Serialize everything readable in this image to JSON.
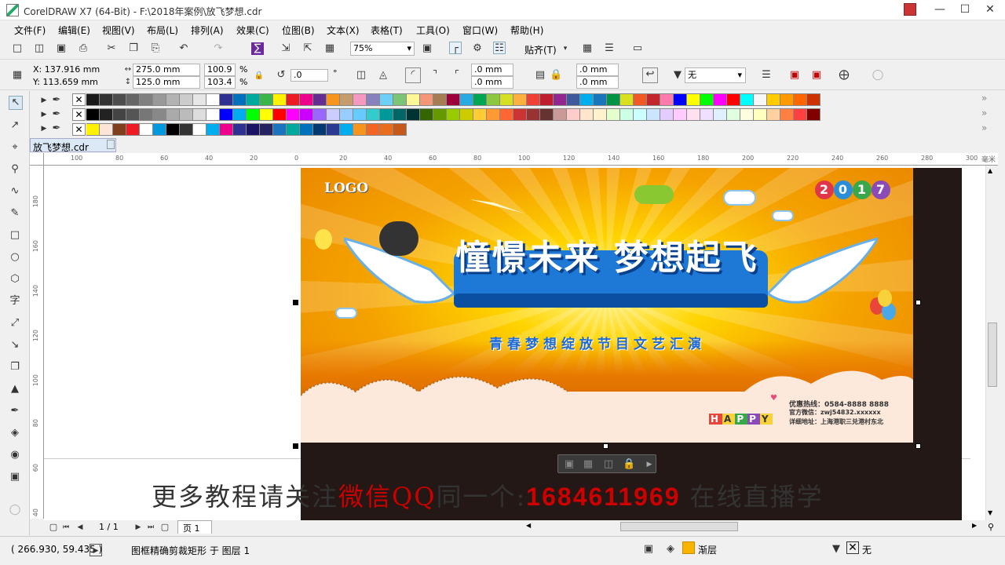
{
  "window": {
    "title": "CorelDRAW X7 (64-Bit) - F:\\2018年案例\\放飞梦想.cdr"
  },
  "menu": [
    "文件(F)",
    "编辑(E)",
    "视图(V)",
    "布局(L)",
    "排列(A)",
    "效果(C)",
    "位图(B)",
    "文本(X)",
    "表格(T)",
    "工具(O)",
    "窗口(W)",
    "帮助(H)"
  ],
  "toolbar": {
    "zoom": "75%",
    "snap": "贴齐(T)"
  },
  "propbar": {
    "x": "X: 137.916 mm",
    "y": "Y: 113.659 mm",
    "w": "275.0 mm",
    "h": "125.0 mm",
    "sx": "100.9",
    "sy": "103.4",
    "pct": "%",
    "rot": ".0",
    "deg": "°",
    "c1": ".0 mm",
    "c2": ".0 mm",
    "c3": ".0 mm",
    "c4": ".0 mm",
    "outline": "无"
  },
  "palette": {
    "row1": [
      "#1a1a1a",
      "#333",
      "#4d4d4d",
      "#666",
      "#808080",
      "#999",
      "#b3b3b3",
      "#ccc",
      "#e6e6e6",
      "#fff",
      "#2e3192",
      "#0071bc",
      "#00a99d",
      "#39b54a",
      "#fff200",
      "#ed1c24",
      "#ec008c",
      "#662d91",
      "#f7941d",
      "#c69c6d",
      "#f49ac1",
      "#8781bd",
      "#6dcff6",
      "#7cc576",
      "#fff799",
      "#f69679",
      "#a67c52",
      "#9e0039",
      "#29abe2",
      "#00a651",
      "#8dc63f",
      "#d7df23",
      "#fbb040",
      "#ef4136",
      "#be1e2d",
      "#92278f",
      "#3f5a9b",
      "#00aeef",
      "#1b75bb",
      "#009444",
      "#d9e021",
      "#f15a24",
      "#c1272d",
      "#ff7bac",
      "#0000ff",
      "#ffff00",
      "#00ff00",
      "#ff00ff",
      "#ff0000",
      "#00ffff",
      "#f7f7f7",
      "#ffcc00",
      "#ff9900",
      "#ff6600",
      "#cc3300"
    ],
    "row2": [
      "#000",
      "#222",
      "#444",
      "#555",
      "#777",
      "#888",
      "#aaa",
      "#bbb",
      "#ddd",
      "#fff",
      "#0000ff",
      "#00aeef",
      "#00ff00",
      "#ffff00",
      "#ff0000",
      "#ff00ff",
      "#cc00ff",
      "#9966ff",
      "#ccccff",
      "#99ccff",
      "#66ccff",
      "#33cccc",
      "#009999",
      "#006666",
      "#003333",
      "#336600",
      "#669900",
      "#99cc00",
      "#cccc00",
      "#ffcc33",
      "#ff9933",
      "#ff6633",
      "#cc3333",
      "#993333",
      "#663333",
      "#cc9999",
      "#ffcccc",
      "#ffe5cc",
      "#fff2cc",
      "#e5ffcc",
      "#ccffe5",
      "#ccffff",
      "#cce5ff",
      "#e5ccff",
      "#ffccff",
      "#ffe0f0",
      "#f0e0ff",
      "#e0f0ff",
      "#e0ffe0",
      "#fffde0",
      "#ffffc0",
      "#ffd0a0",
      "#ff8040",
      "#ff4040",
      "#800000"
    ],
    "row3": [
      "#fff200",
      "#fce4d6",
      "#7f3f1f",
      "#ed1c24",
      "#ffffff",
      "#0099dd",
      "#000000",
      "#333333",
      "#ffffff",
      "#00aeef",
      "#ec008c",
      "#2e3192",
      "#1b1464",
      "#262262",
      "#1c75bc",
      "#00a99d",
      "#0072bc",
      "#003a70",
      "#2b3990",
      "#00aeef",
      "#f7941d",
      "#f26522",
      "#e86d1f",
      "#c4591b"
    ]
  },
  "tab": {
    "doc": "放飞梦想.cdr"
  },
  "ruler": {
    "unit": "毫米",
    "h_ticks": [
      "100",
      "80",
      "60",
      "40",
      "20",
      "0",
      "20",
      "40",
      "60",
      "80",
      "100",
      "120",
      "140",
      "160",
      "180",
      "200",
      "220",
      "240",
      "260",
      "280",
      "300"
    ],
    "v_ticks": [
      "180",
      "160",
      "140",
      "120",
      "100",
      "80",
      "60",
      "40"
    ]
  },
  "artwork": {
    "logo": "LOGO",
    "year": "2017",
    "headline": "憧憬未来 梦想起飞",
    "subtitle": "青春梦想绽放节目文艺汇演",
    "hotline": "优惠热线：0584-8888 8888",
    "wechat": "官方微信：zwj54832.xxxxxx",
    "address": "详细地址：上海港职三兑港村东北",
    "happy": "HAPPY"
  },
  "watermark": {
    "part1": "更多教程请关注",
    "part2": "微信QQ",
    "part3": "同一个:",
    "number": "1684611969",
    "part4": " 在线直播学"
  },
  "pagenav": {
    "pages": "1 / 1",
    "page_tab": "页 1"
  },
  "status": {
    "coords": "( 266.930, 59.435 )",
    "message": "图框精确剪裁矩形 于 图层 1",
    "fill": "渐层",
    "outline": "无"
  }
}
